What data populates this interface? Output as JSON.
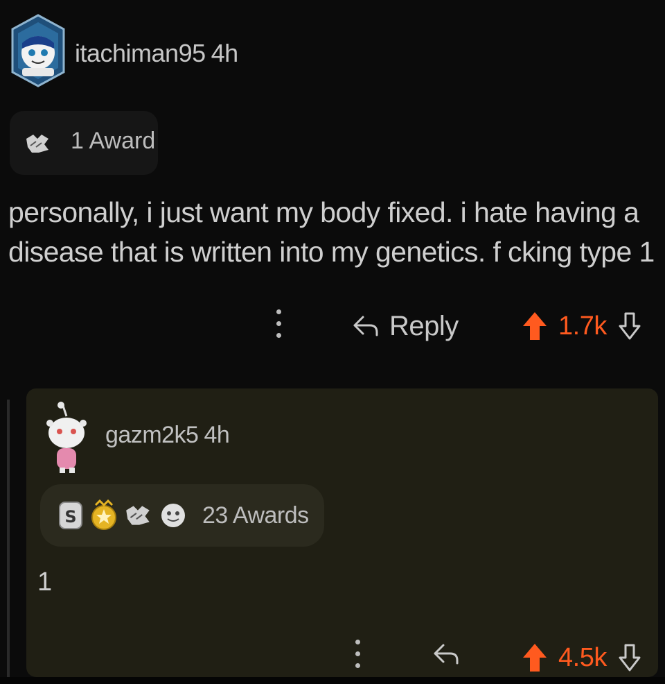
{
  "comment": {
    "username": "itachiman95",
    "time": "4h",
    "award_label": "1 Award",
    "body": "personally, i just want my body fixed. i hate having a disease that is written into my genetics. f cking type 1",
    "reply_label": "Reply",
    "score": "1.7k"
  },
  "reply": {
    "username": "gazm2k5",
    "time": "4h",
    "award_label": "23 Awards",
    "award_icons": [
      "silver-award-icon",
      "gold-award-icon",
      "helpful-hand-award-icon",
      "wholesome-award-icon"
    ],
    "body": "1",
    "score": "4.5k"
  },
  "colors": {
    "background": "#0b0b0b",
    "highlight_background": "#201f14",
    "upvote": "#ff5a1f",
    "text": "#c9c9c9"
  }
}
